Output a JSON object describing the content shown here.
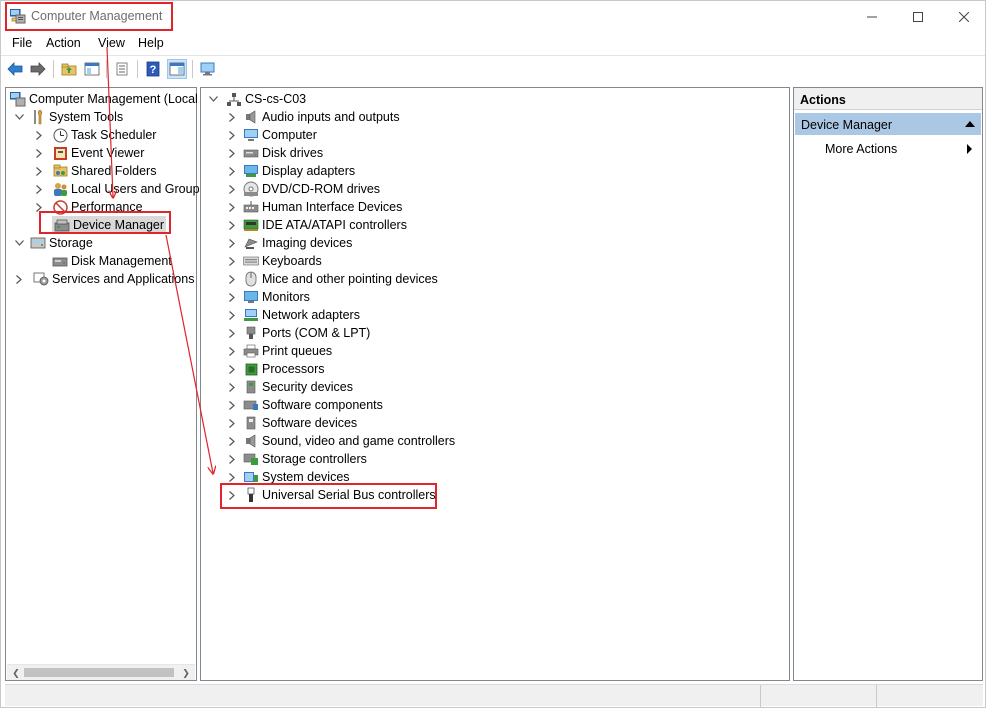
{
  "window": {
    "title": "Computer Management",
    "controls": {
      "minimize": "—",
      "maximize": "☐",
      "close": "✕"
    }
  },
  "menu": [
    "File",
    "Action",
    "View",
    "Help"
  ],
  "left_tree": {
    "root": "Computer Management (Local",
    "system_tools": "System Tools",
    "task_scheduler": "Task Scheduler",
    "event_viewer": "Event Viewer",
    "shared_folders": "Shared Folders",
    "local_users": "Local Users and Groups",
    "performance": "Performance",
    "device_manager": "Device Manager",
    "storage": "Storage",
    "disk_management": "Disk Management",
    "services": "Services and Applications"
  },
  "device_tree": {
    "computer_name": "CS-cs-C03",
    "categories": [
      {
        "label": "Audio inputs and outputs",
        "icon": "speaker-icon"
      },
      {
        "label": "Computer",
        "icon": "computer-icon"
      },
      {
        "label": "Disk drives",
        "icon": "disk-drive-icon"
      },
      {
        "label": "Display adapters",
        "icon": "display-adapter-icon"
      },
      {
        "label": "DVD/CD-ROM drives",
        "icon": "dvd-icon"
      },
      {
        "label": "Human Interface Devices",
        "icon": "hid-icon"
      },
      {
        "label": "IDE ATA/ATAPI controllers",
        "icon": "ide-controller-icon"
      },
      {
        "label": "Imaging devices",
        "icon": "camera-icon"
      },
      {
        "label": "Keyboards",
        "icon": "keyboard-icon"
      },
      {
        "label": "Mice and other pointing devices",
        "icon": "mouse-icon"
      },
      {
        "label": "Monitors",
        "icon": "monitor-icon"
      },
      {
        "label": "Network adapters",
        "icon": "network-adapter-icon"
      },
      {
        "label": "Ports (COM & LPT)",
        "icon": "port-icon"
      },
      {
        "label": "Print queues",
        "icon": "printer-icon"
      },
      {
        "label": "Processors",
        "icon": "processor-icon"
      },
      {
        "label": "Security devices",
        "icon": "security-device-icon"
      },
      {
        "label": "Software components",
        "icon": "software-component-icon"
      },
      {
        "label": "Software devices",
        "icon": "software-device-icon"
      },
      {
        "label": "Sound, video and game controllers",
        "icon": "sound-icon"
      },
      {
        "label": "Storage controllers",
        "icon": "storage-controller-icon"
      },
      {
        "label": "System devices",
        "icon": "system-device-icon"
      },
      {
        "label": "Universal Serial Bus controllers",
        "icon": "usb-icon"
      }
    ]
  },
  "actions": {
    "header": "Actions",
    "section": "Device Manager",
    "more": "More Actions"
  },
  "colors": {
    "annotation": "#e0242b",
    "selection": "#d9d9d9",
    "actions_section": "#aac8e4"
  }
}
